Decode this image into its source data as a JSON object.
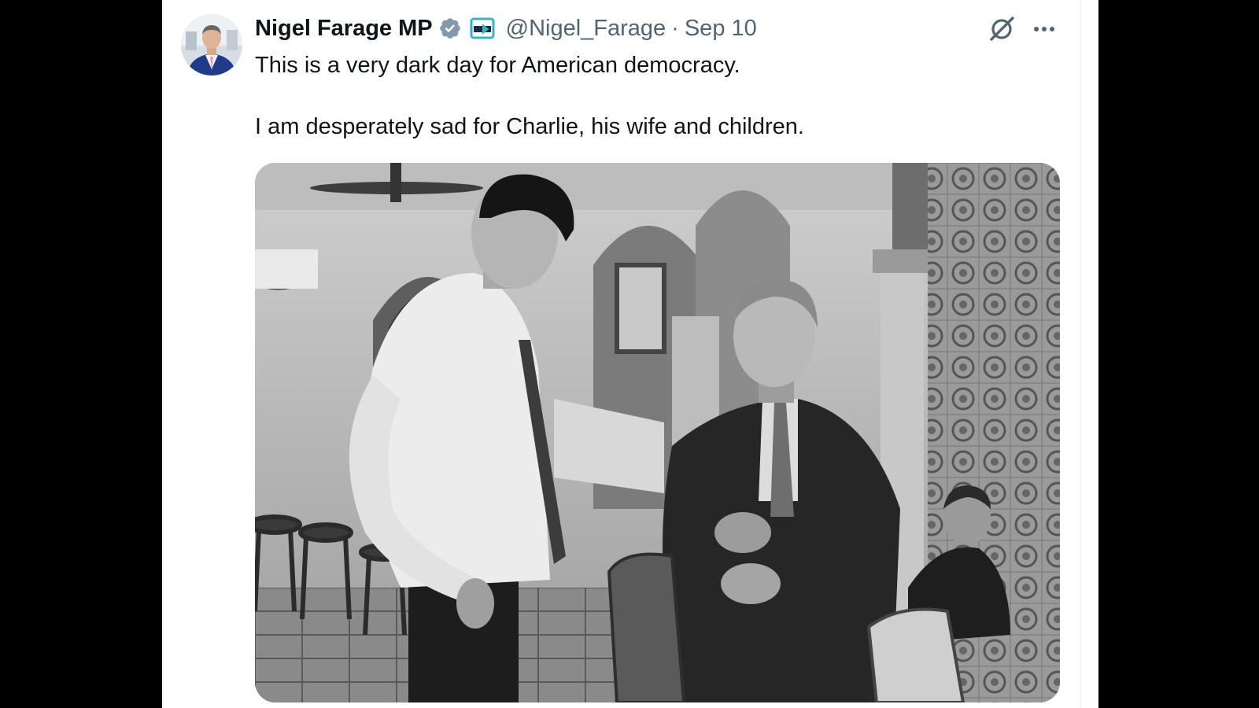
{
  "tweet": {
    "author": {
      "display_name": "Nigel Farage MP",
      "handle": "@Nigel_Farage",
      "verified": true,
      "avatar_icon": "avatar-photo"
    },
    "separator": "·",
    "date": "Sep 10",
    "text": [
      "This is a very dark day for American democracy.",
      "I am desperately sad for Charlie, his wife and children."
    ],
    "media": {
      "type": "photo",
      "style": "black-and-white",
      "icon": "photo"
    }
  },
  "icons": {
    "verified": "verified-badge-icon",
    "affiliate": "affiliate-badge-icon",
    "grok": "grok-icon",
    "more": "more-options-icon"
  },
  "colors": {
    "text_primary": "#0f1419",
    "text_secondary": "#536471",
    "verified_blue": "#829aab",
    "background": "#ffffff",
    "page_background": "#000000"
  }
}
